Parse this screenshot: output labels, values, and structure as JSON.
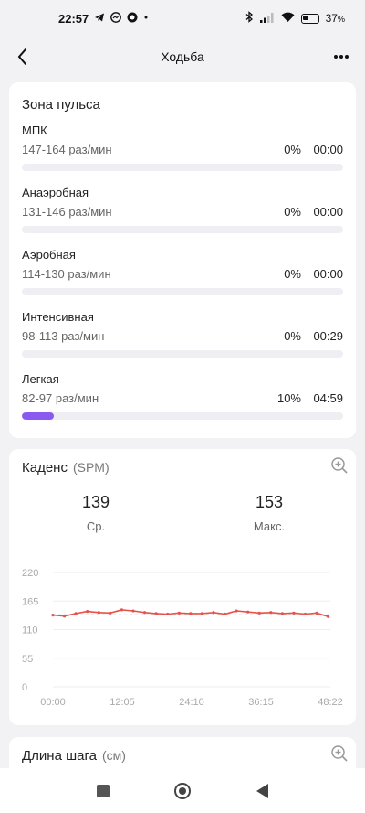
{
  "status": {
    "time": "22:57",
    "battery": "37",
    "battery_unit": "%",
    "left_icons": [
      "telegram-icon",
      "messenger-icon",
      "app-icon",
      "dot-icon"
    ],
    "right_icons": [
      "bluetooth-icon",
      "signal-icon",
      "wifi-icon",
      "battery-icon"
    ]
  },
  "header": {
    "title": "Ходьба"
  },
  "heart_zones": {
    "title": "Зона пульса",
    "accent": "#8a59ef",
    "zones": [
      {
        "name": "МПК",
        "range": "147-164 раз/мин",
        "percent": "0%",
        "time": "00:00",
        "fill": 0
      },
      {
        "name": "Анаэробная",
        "range": "131-146 раз/мин",
        "percent": "0%",
        "time": "00:00",
        "fill": 0
      },
      {
        "name": "Аэробная",
        "range": "114-130 раз/мин",
        "percent": "0%",
        "time": "00:00",
        "fill": 0
      },
      {
        "name": "Интенсивная",
        "range": "98-113 раз/мин",
        "percent": "0%",
        "time": "00:29",
        "fill": 0
      },
      {
        "name": "Легкая",
        "range": "82-97 раз/мин",
        "percent": "10%",
        "time": "04:59",
        "fill": 0.1
      }
    ]
  },
  "cadence": {
    "title": "Каденс",
    "unit": "(SPM)",
    "avg_value": "139",
    "avg_label": "Ср.",
    "max_value": "153",
    "max_label": "Макс."
  },
  "chart_data": {
    "type": "line",
    "title": "",
    "xlabel": "",
    "ylabel": "",
    "ylim": [
      0,
      220
    ],
    "y_ticks": [
      "220",
      "165",
      "110",
      "55",
      "0"
    ],
    "x_ticks": [
      "00:00",
      "12:05",
      "24:10",
      "36:15",
      "48:22"
    ],
    "reference_line": 139,
    "series_color": "#e5534b",
    "series": [
      {
        "x": [
          0,
          2,
          4,
          6,
          8,
          10,
          12,
          14,
          16,
          18,
          20,
          22,
          24,
          26,
          28,
          30,
          32,
          34,
          36,
          38,
          40,
          42,
          44,
          46,
          48
        ],
        "values": [
          138,
          136,
          141,
          145,
          143,
          142,
          148,
          146,
          143,
          141,
          140,
          142,
          141,
          141,
          143,
          140,
          146,
          144,
          142,
          143,
          141,
          142,
          140,
          142,
          135
        ]
      }
    ]
  },
  "stride": {
    "title": "Длина шага",
    "unit": "(см)"
  }
}
